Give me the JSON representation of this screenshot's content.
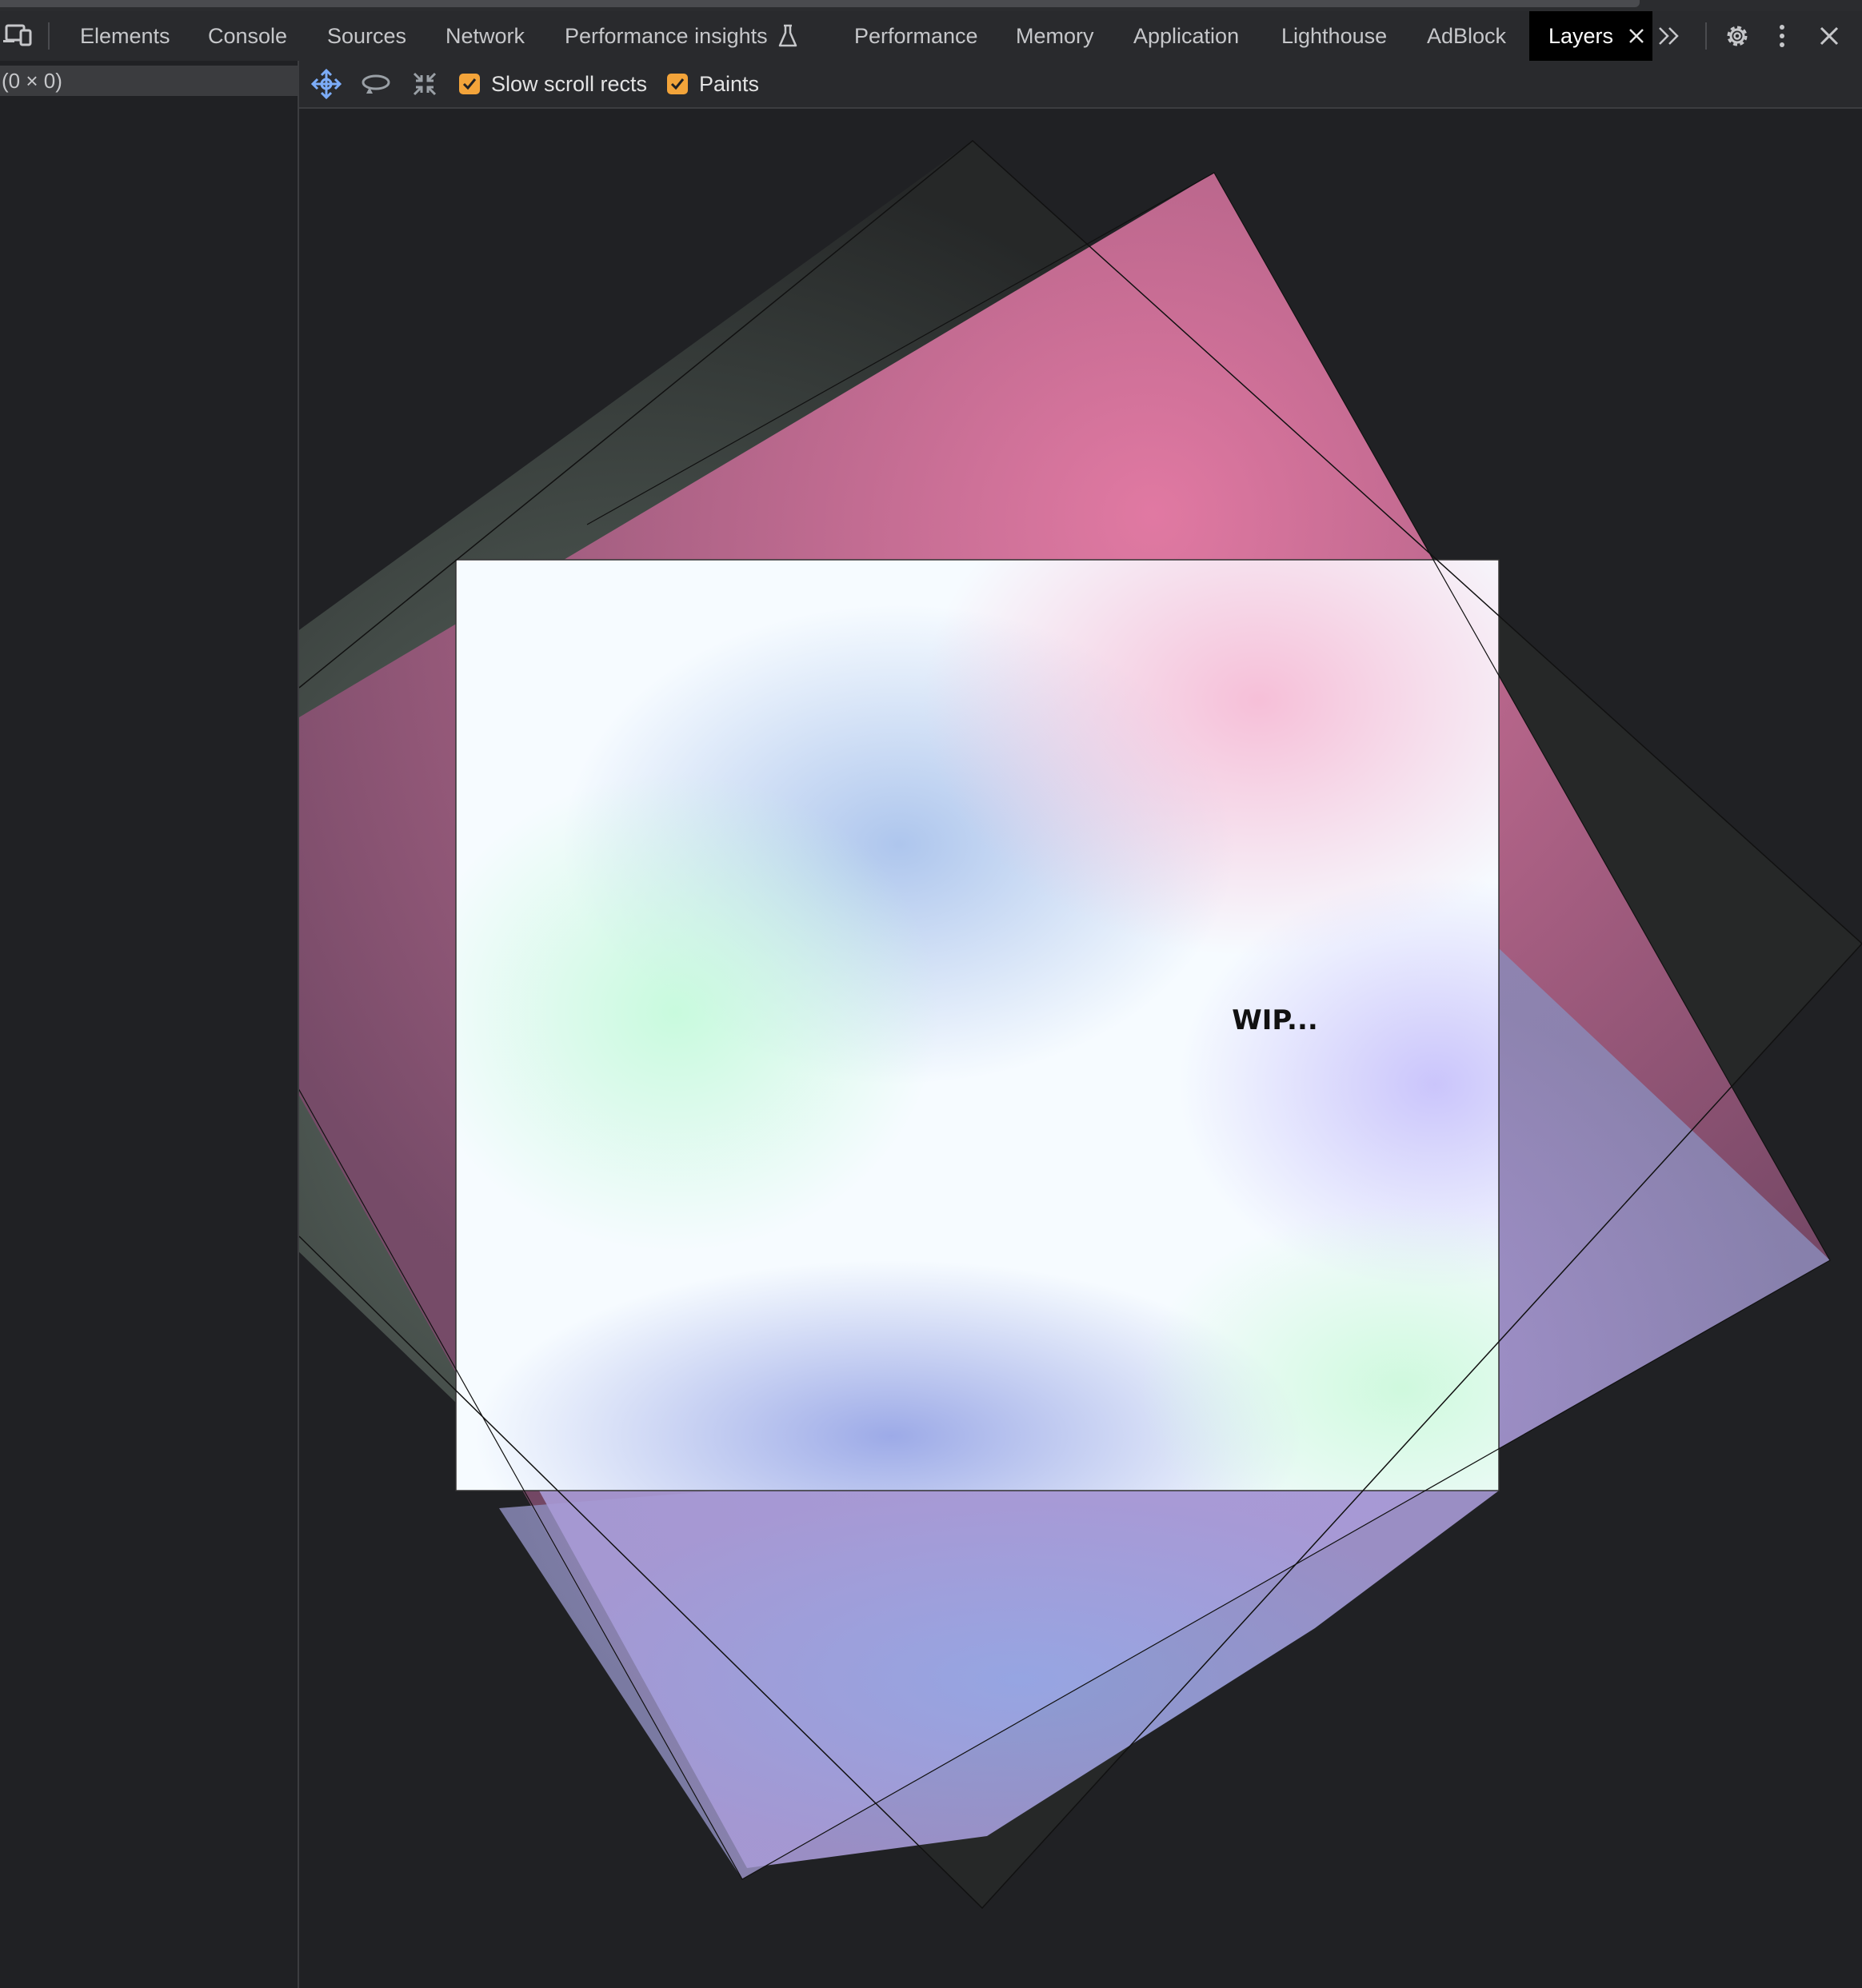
{
  "tabs": [
    {
      "label": "Elements"
    },
    {
      "label": "Console"
    },
    {
      "label": "Sources"
    },
    {
      "label": "Network"
    },
    {
      "label": "Performance insights"
    },
    {
      "label": "Performance"
    },
    {
      "label": "Memory"
    },
    {
      "label": "Application"
    },
    {
      "label": "Lighthouse"
    },
    {
      "label": "AdBlock"
    },
    {
      "label": "Layers",
      "active": true
    }
  ],
  "icons": {
    "device_toggle": "device-toolbar-icon",
    "experiment": "flask-icon",
    "close_tab": "close-icon",
    "more_tabs": "chevron-double-right-icon",
    "settings": "gear-icon",
    "menu": "kebab-menu-icon",
    "close_devtools": "close-icon",
    "pan": "pan-move-icon",
    "rotate": "rotate-icon",
    "reset": "reset-transform-icon"
  },
  "layers_tree": {
    "root_label": "(0 × 0)"
  },
  "toolbar": {
    "slow_scroll_label": "Slow scroll rects",
    "slow_scroll_checked": true,
    "paints_label": "Paints",
    "paints_checked": true
  },
  "viewport": {
    "content_text": "WIP..."
  },
  "colors": {
    "checkbox": "#f3a43a",
    "active_icon": "#7cacf8",
    "background": "#202124"
  }
}
